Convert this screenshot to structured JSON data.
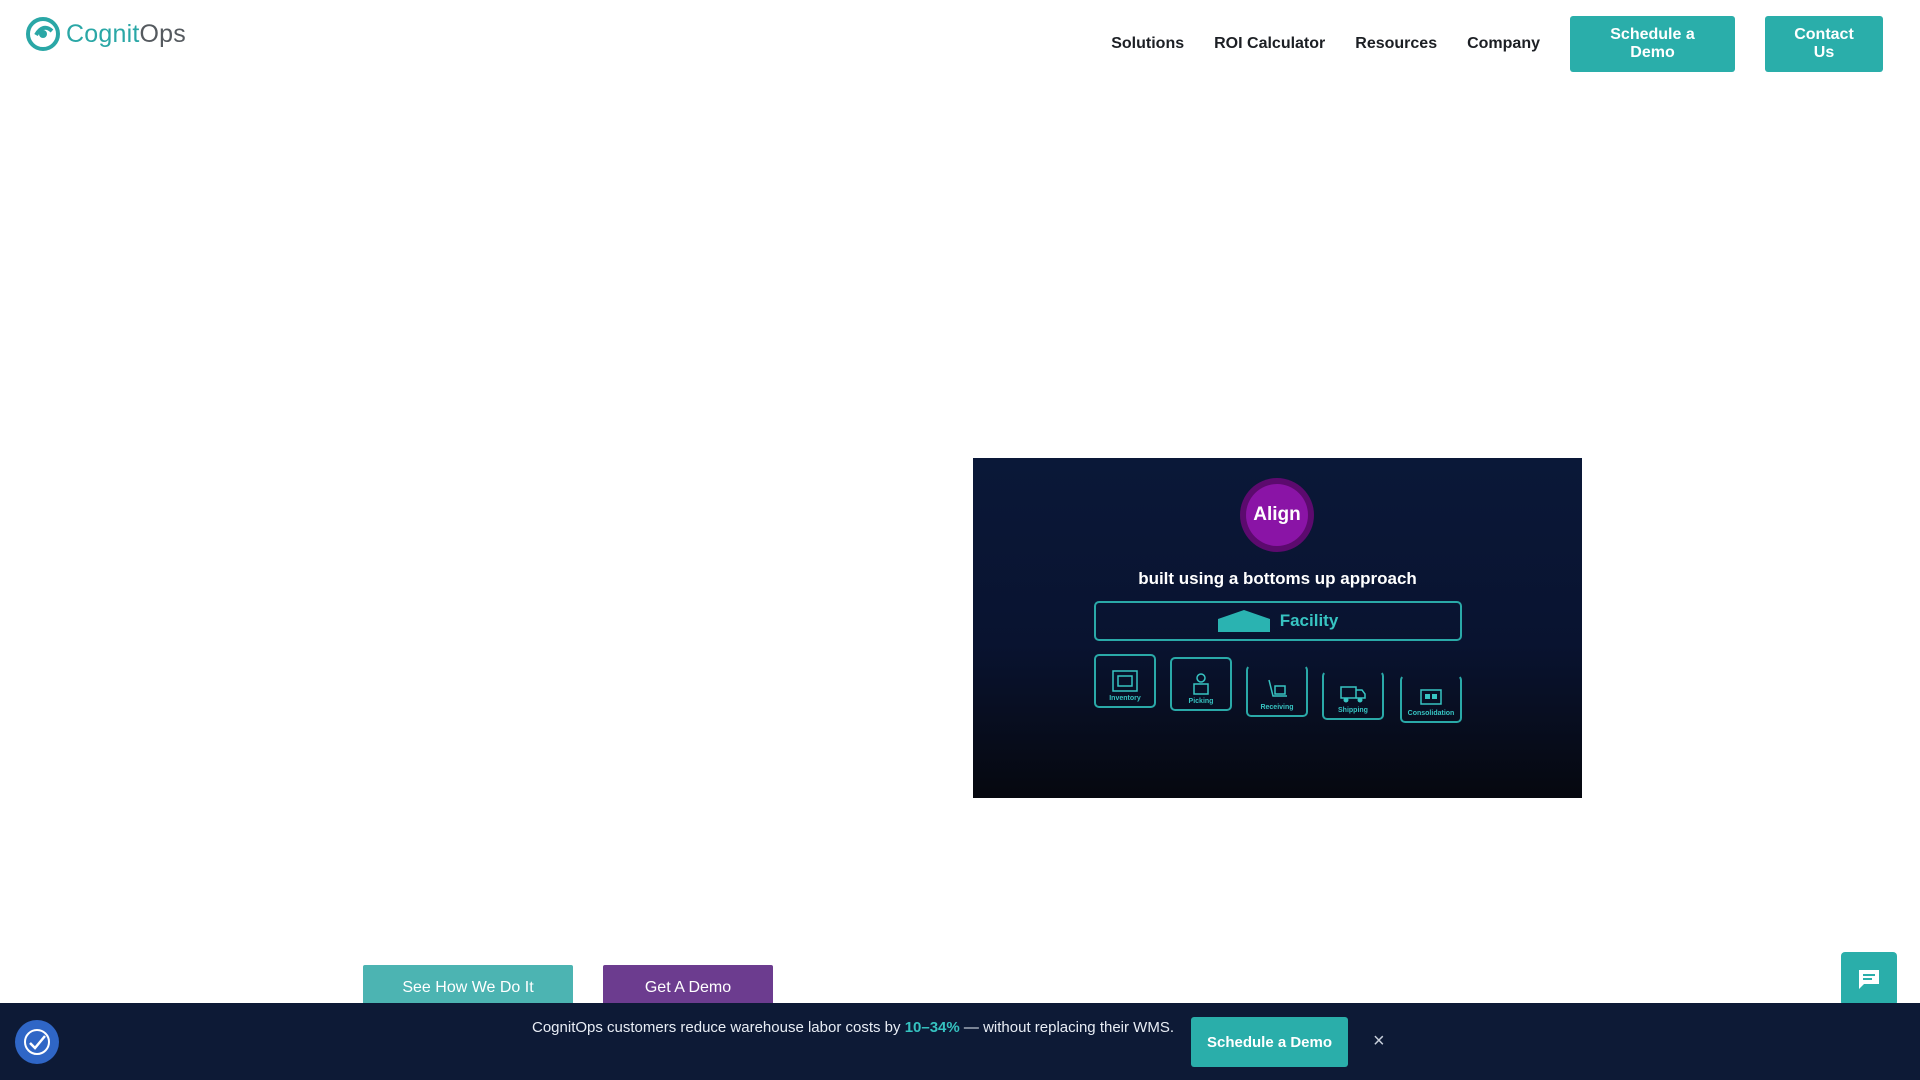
{
  "header": {
    "logo": {
      "part1": "Cognit",
      "part2": "Ops"
    },
    "nav": [
      {
        "label": "Solutions"
      },
      {
        "label": "ROI Calculator"
      },
      {
        "label": "Resources"
      },
      {
        "label": "Company"
      }
    ],
    "schedule_demo_label": "Schedule a Demo",
    "contact_label": "Contact Us"
  },
  "video": {
    "badge": "Align",
    "subtitle": "built using a bottoms up approach",
    "facility_label": "Facility",
    "modules": [
      "Inventory",
      "Picking",
      "Receiving",
      "Shipping",
      "Consolidation"
    ]
  },
  "cta": {
    "see_how_label": "See How We Do It",
    "get_demo_label": "Get A Demo"
  },
  "banner": {
    "text_before": "CognitOps customers reduce warehouse labor costs by ",
    "highlight": "10–34%",
    "text_after": " — without replacing their WMS.",
    "button_label": "Schedule a Demo",
    "close_symbol": "×"
  },
  "icons": {
    "chat": "chat-icon",
    "accessibility": "accessibility-icon",
    "close": "close-icon"
  },
  "colors": {
    "brand_teal": "#2aaeaa",
    "cta_purple": "#6c3c8f",
    "banner_navy": "#0d1a36",
    "video_bg": "#0a1838",
    "align_purple": "#8a14a6"
  }
}
